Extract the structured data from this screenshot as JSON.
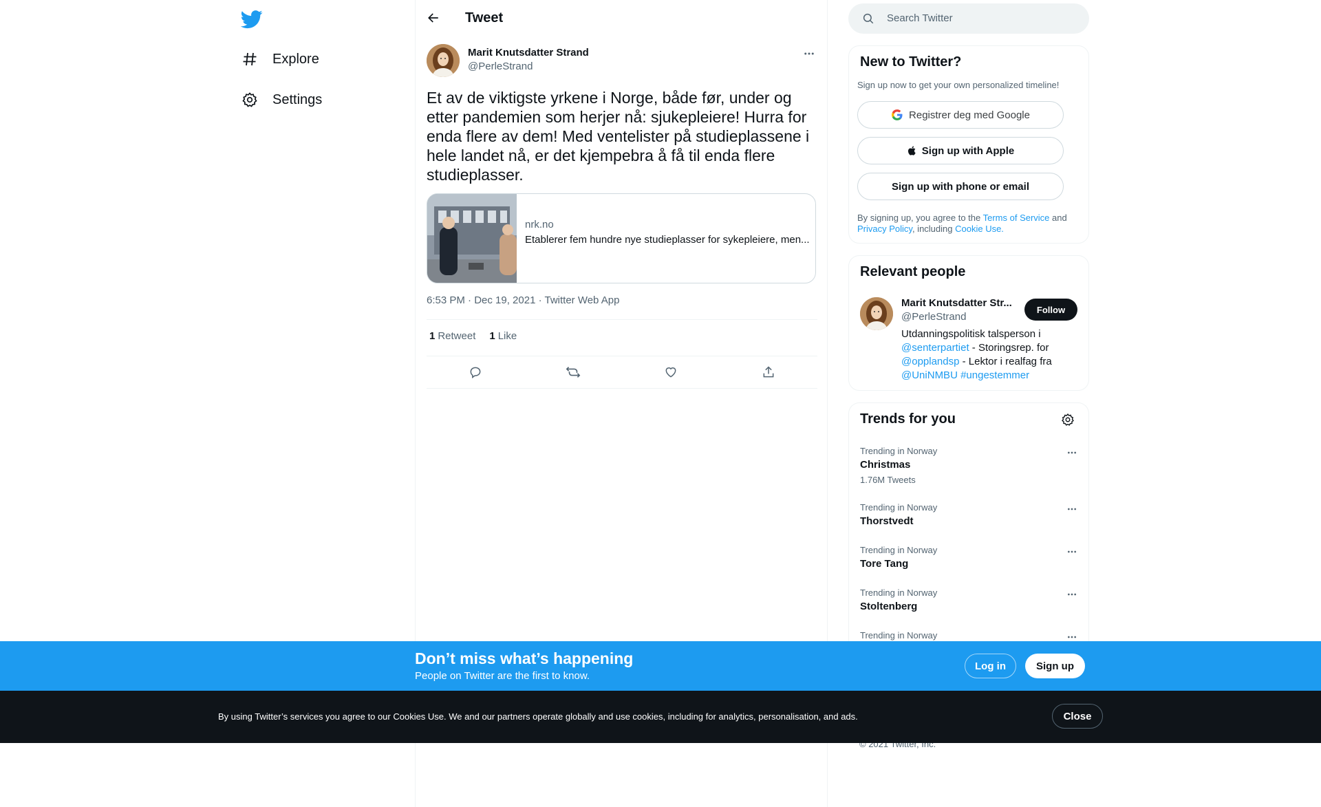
{
  "nav": {
    "explore_label": "Explore",
    "settings_label": "Settings"
  },
  "header": {
    "title": "Tweet"
  },
  "tweet": {
    "author_name": "Marit Knutsdatter Strand",
    "author_handle": "@PerleStrand",
    "text": "Et av de viktigste yrkene i Norge, både før, under og etter pandemien som herjer nå: sjukepleiere! Hurra for enda flere av dem! Med ventelister på studieplassene i hele landet nå, er det kjempebra å få til enda flere studieplasser.",
    "card": {
      "domain": "nrk.no",
      "description": "Etablerer fem hundre nye studieplasser for sykepleiere, men..."
    },
    "meta": "6:53 PM · Dec 19, 2021 · Twitter Web App",
    "retweets_count": "1",
    "retweets_label": "Retweet",
    "likes_count": "1",
    "likes_label": "Like"
  },
  "search": {
    "placeholder": "Search Twitter"
  },
  "signup_panel": {
    "title": "New to Twitter?",
    "subtitle": "Sign up now to get your own personalized timeline!",
    "google_label": "Registrer deg med Google",
    "apple_label": "Sign up with Apple",
    "phone_label": "Sign up with phone or email",
    "legal_1": "By signing up, you agree to the ",
    "terms": "Terms of Service",
    "legal_2": " and ",
    "privacy": "Privacy Policy",
    "legal_3": ", including ",
    "cookie": "Cookie Use."
  },
  "relevant": {
    "title": "Relevant people",
    "name": "Marit Knutsdatter Str...",
    "handle": "@PerleStrand",
    "follow_label": "Follow",
    "bio_1": "Utdanningspolitisk talsperson i ",
    "bio_link_1": "@senterpartiet",
    "bio_2": " - Storingsrep. for ",
    "bio_link_2": "@opplandsp",
    "bio_3": " - Lektor i realfag fra ",
    "bio_link_3": "@UniNMBU",
    "bio_link_4": "#ungestemmer"
  },
  "trends": {
    "title": "Trends for you",
    "items": [
      {
        "context": "Trending in Norway",
        "name": "Christmas",
        "count": "1.76M Tweets"
      },
      {
        "context": "Trending in Norway",
        "name": "Thorstvedt",
        "count": ""
      },
      {
        "context": "Trending in Norway",
        "name": "Tore Tang",
        "count": ""
      },
      {
        "context": "Trending in Norway",
        "name": "Stoltenberg",
        "count": ""
      },
      {
        "context": "Trending in Norway",
        "name": "",
        "count": ""
      }
    ]
  },
  "footer": {
    "copyright": "© 2021 Twitter, Inc."
  },
  "dont_miss": {
    "heading": "Don’t miss what’s happening",
    "sub": "People on Twitter are the first to know.",
    "login_label": "Log in",
    "signup_label": "Sign up"
  },
  "cookies": {
    "text": "By using Twitter’s services you agree to our Cookies Use. We and our partners operate globally and use cookies, including for analytics, personalisation, and ads.",
    "close_label": "Close"
  },
  "colors": {
    "brand_blue": "#1d9bf0",
    "text": "#0f1419",
    "muted": "#536471",
    "dark_bar": "#0f1419"
  },
  "icons": [
    "twitter-logo-icon",
    "hashtag-icon",
    "gear-icon",
    "back-arrow-icon",
    "more-icon",
    "search-icon",
    "google-icon",
    "apple-icon",
    "reply-icon",
    "retweet-icon",
    "like-icon",
    "share-icon"
  ]
}
